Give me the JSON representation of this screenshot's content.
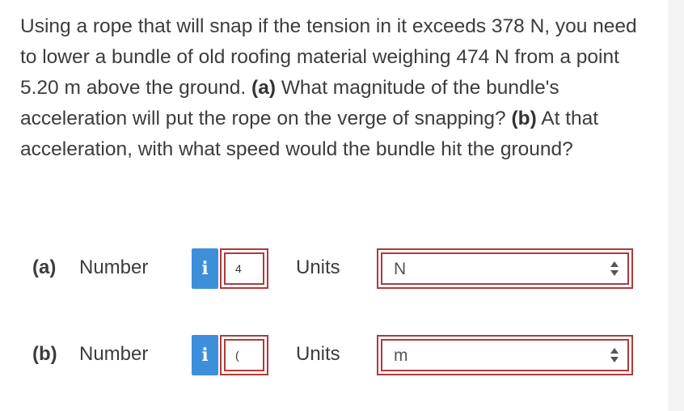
{
  "question": {
    "text_1": "Using a rope that will snap if the tension in it exceeds 378 N, you need to lower a bundle of old roofing material weighing 474 N from a point 5.20 m above the ground.",
    "part_a_tag": "(a)",
    "text_2": "What magnitude of the bundle's acceleration will put the rope on the verge of snapping?",
    "part_b_tag": "(b)",
    "text_3": "At that acceleration, with what speed would the bundle hit the ground?"
  },
  "answers": [
    {
      "part_label": "(a)",
      "number_label": "Number",
      "info_icon": "i",
      "number_value": "4",
      "units_label": "Units",
      "units_value": "N"
    },
    {
      "part_label": "(b)",
      "number_label": "Number",
      "info_icon": "i",
      "number_value": "(",
      "units_label": "Units",
      "units_value": "m"
    }
  ],
  "colors": {
    "info_button": "#3d8fdc",
    "input_border_error": "#b03a3a",
    "text": "#3c3c3c"
  },
  "icons": {
    "info": "info-icon",
    "select": "up-down-arrows-icon"
  }
}
